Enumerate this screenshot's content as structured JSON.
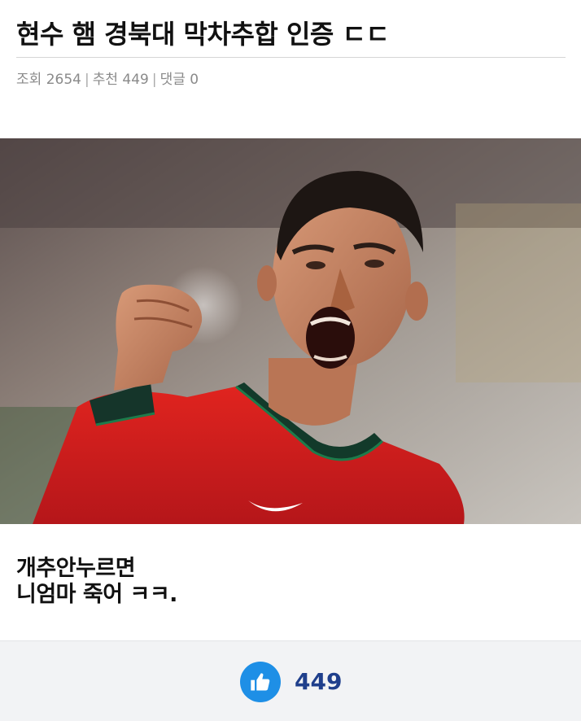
{
  "post": {
    "title": "현수 햄 경북대 막차추합 인증 ㄷㄷ",
    "meta": {
      "views_label": "조회",
      "views": "2654",
      "recommend_label": "추천",
      "recommends": "449",
      "comments_label": "댓글",
      "comments": "0"
    },
    "image": {
      "description_icon": "celebration-photo"
    },
    "body_lines": [
      "개추안누르면",
      "니엄마 죽어 ㅋㅋ."
    ]
  },
  "footer": {
    "like_icon": "thumbs-up-icon",
    "like_count": "449",
    "accent_color": "#1e8fe6",
    "count_color": "#1f3f8c"
  }
}
